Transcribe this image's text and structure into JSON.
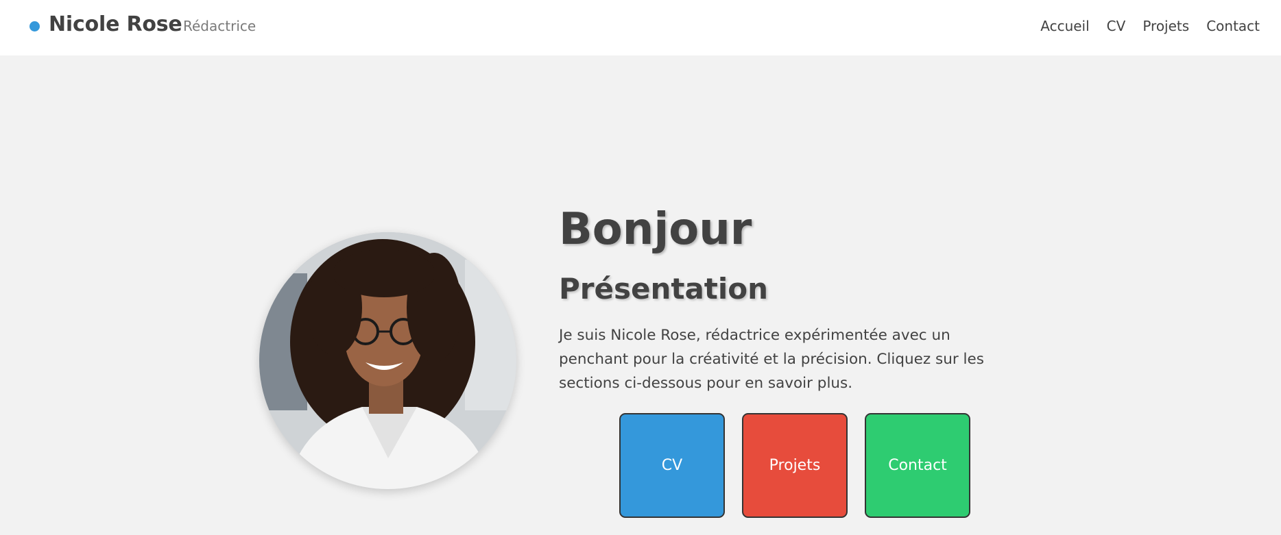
{
  "header": {
    "name": "Nicole Rose",
    "role": "Rédactrice",
    "nav": [
      "Accueil",
      "CV",
      "Projets",
      "Contact"
    ]
  },
  "hero": {
    "greeting": "Bonjour",
    "section_title": "Présentation",
    "intro": "Je suis Nicole Rose, rédactrice expérimentée avec un penchant pour la créativité et la précision. Cliquez sur les sections ci-dessous pour en savoir plus.",
    "tiles": [
      {
        "label": "CV",
        "color": "#3498db"
      },
      {
        "label": "Projets",
        "color": "#e74c3c"
      },
      {
        "label": "Contact",
        "color": "#2ecc71"
      }
    ]
  },
  "colors": {
    "accent": "#3498db",
    "header_bg": "#ffffff",
    "page_bg": "#f2f2f2",
    "text": "#424242"
  }
}
